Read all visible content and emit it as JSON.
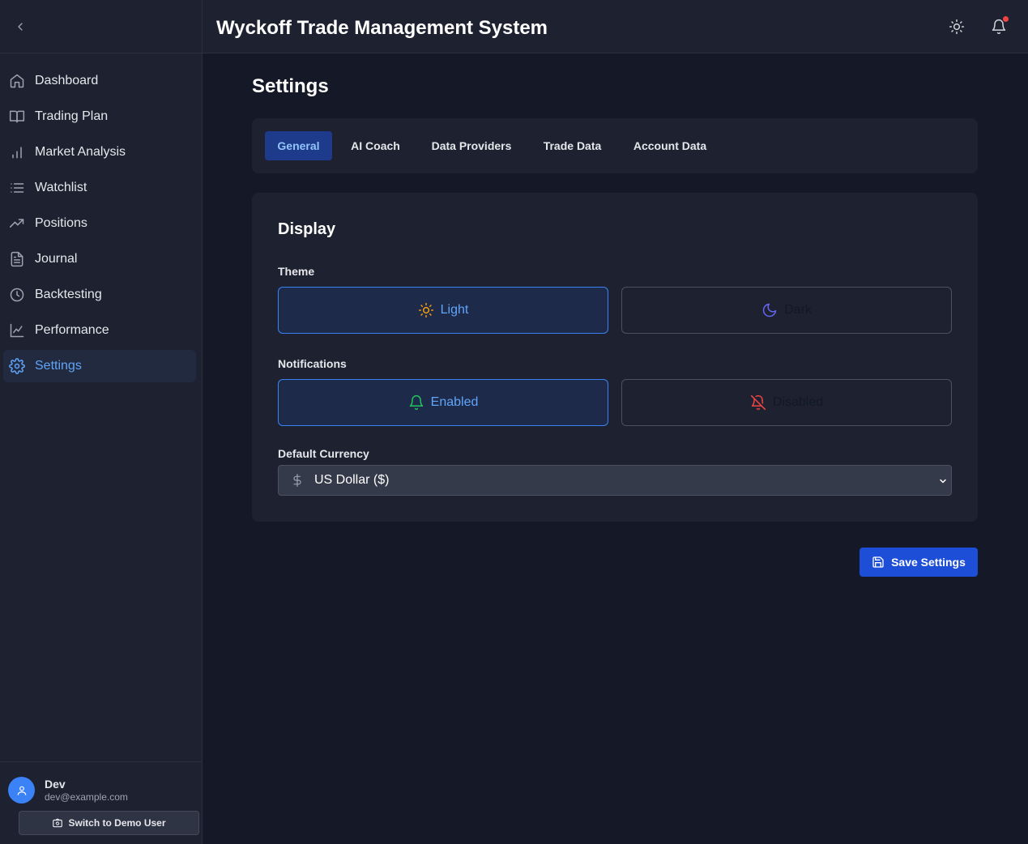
{
  "app": {
    "title": "Wyckoff Trade Management System"
  },
  "sidebar": {
    "items": [
      {
        "label": "Dashboard",
        "icon": "home-icon"
      },
      {
        "label": "Trading Plan",
        "icon": "book-open-icon"
      },
      {
        "label": "Market Analysis",
        "icon": "bar-chart-icon"
      },
      {
        "label": "Watchlist",
        "icon": "list-icon"
      },
      {
        "label": "Positions",
        "icon": "trending-up-icon"
      },
      {
        "label": "Journal",
        "icon": "file-text-icon"
      },
      {
        "label": "Backtesting",
        "icon": "clock-icon"
      },
      {
        "label": "Performance",
        "icon": "line-chart-icon"
      },
      {
        "label": "Settings",
        "icon": "gear-icon",
        "active": true
      }
    ],
    "user": {
      "name": "Dev",
      "email": "dev@example.com"
    },
    "switch_label": "Switch to Demo User"
  },
  "page": {
    "title": "Settings"
  },
  "tabs": [
    {
      "label": "General",
      "active": true
    },
    {
      "label": "AI Coach"
    },
    {
      "label": "Data Providers"
    },
    {
      "label": "Trade Data"
    },
    {
      "label": "Account Data"
    }
  ],
  "display": {
    "title": "Display",
    "theme": {
      "label": "Theme",
      "options": [
        {
          "label": "Light",
          "icon": "sun-icon",
          "selected": true
        },
        {
          "label": "Dark",
          "icon": "moon-icon",
          "selected": false
        }
      ]
    },
    "notifications": {
      "label": "Notifications",
      "options": [
        {
          "label": "Enabled",
          "icon": "bell-icon",
          "selected": true
        },
        {
          "label": "Disabled",
          "icon": "bell-off-icon",
          "selected": false
        }
      ]
    },
    "currency": {
      "label": "Default Currency",
      "value": "US Dollar ($)"
    }
  },
  "actions": {
    "save_label": "Save Settings"
  },
  "colors": {
    "accent": "#3b82f6",
    "background": "#151826",
    "surface": "#1e2230",
    "notification_dot": "#ef4444"
  }
}
